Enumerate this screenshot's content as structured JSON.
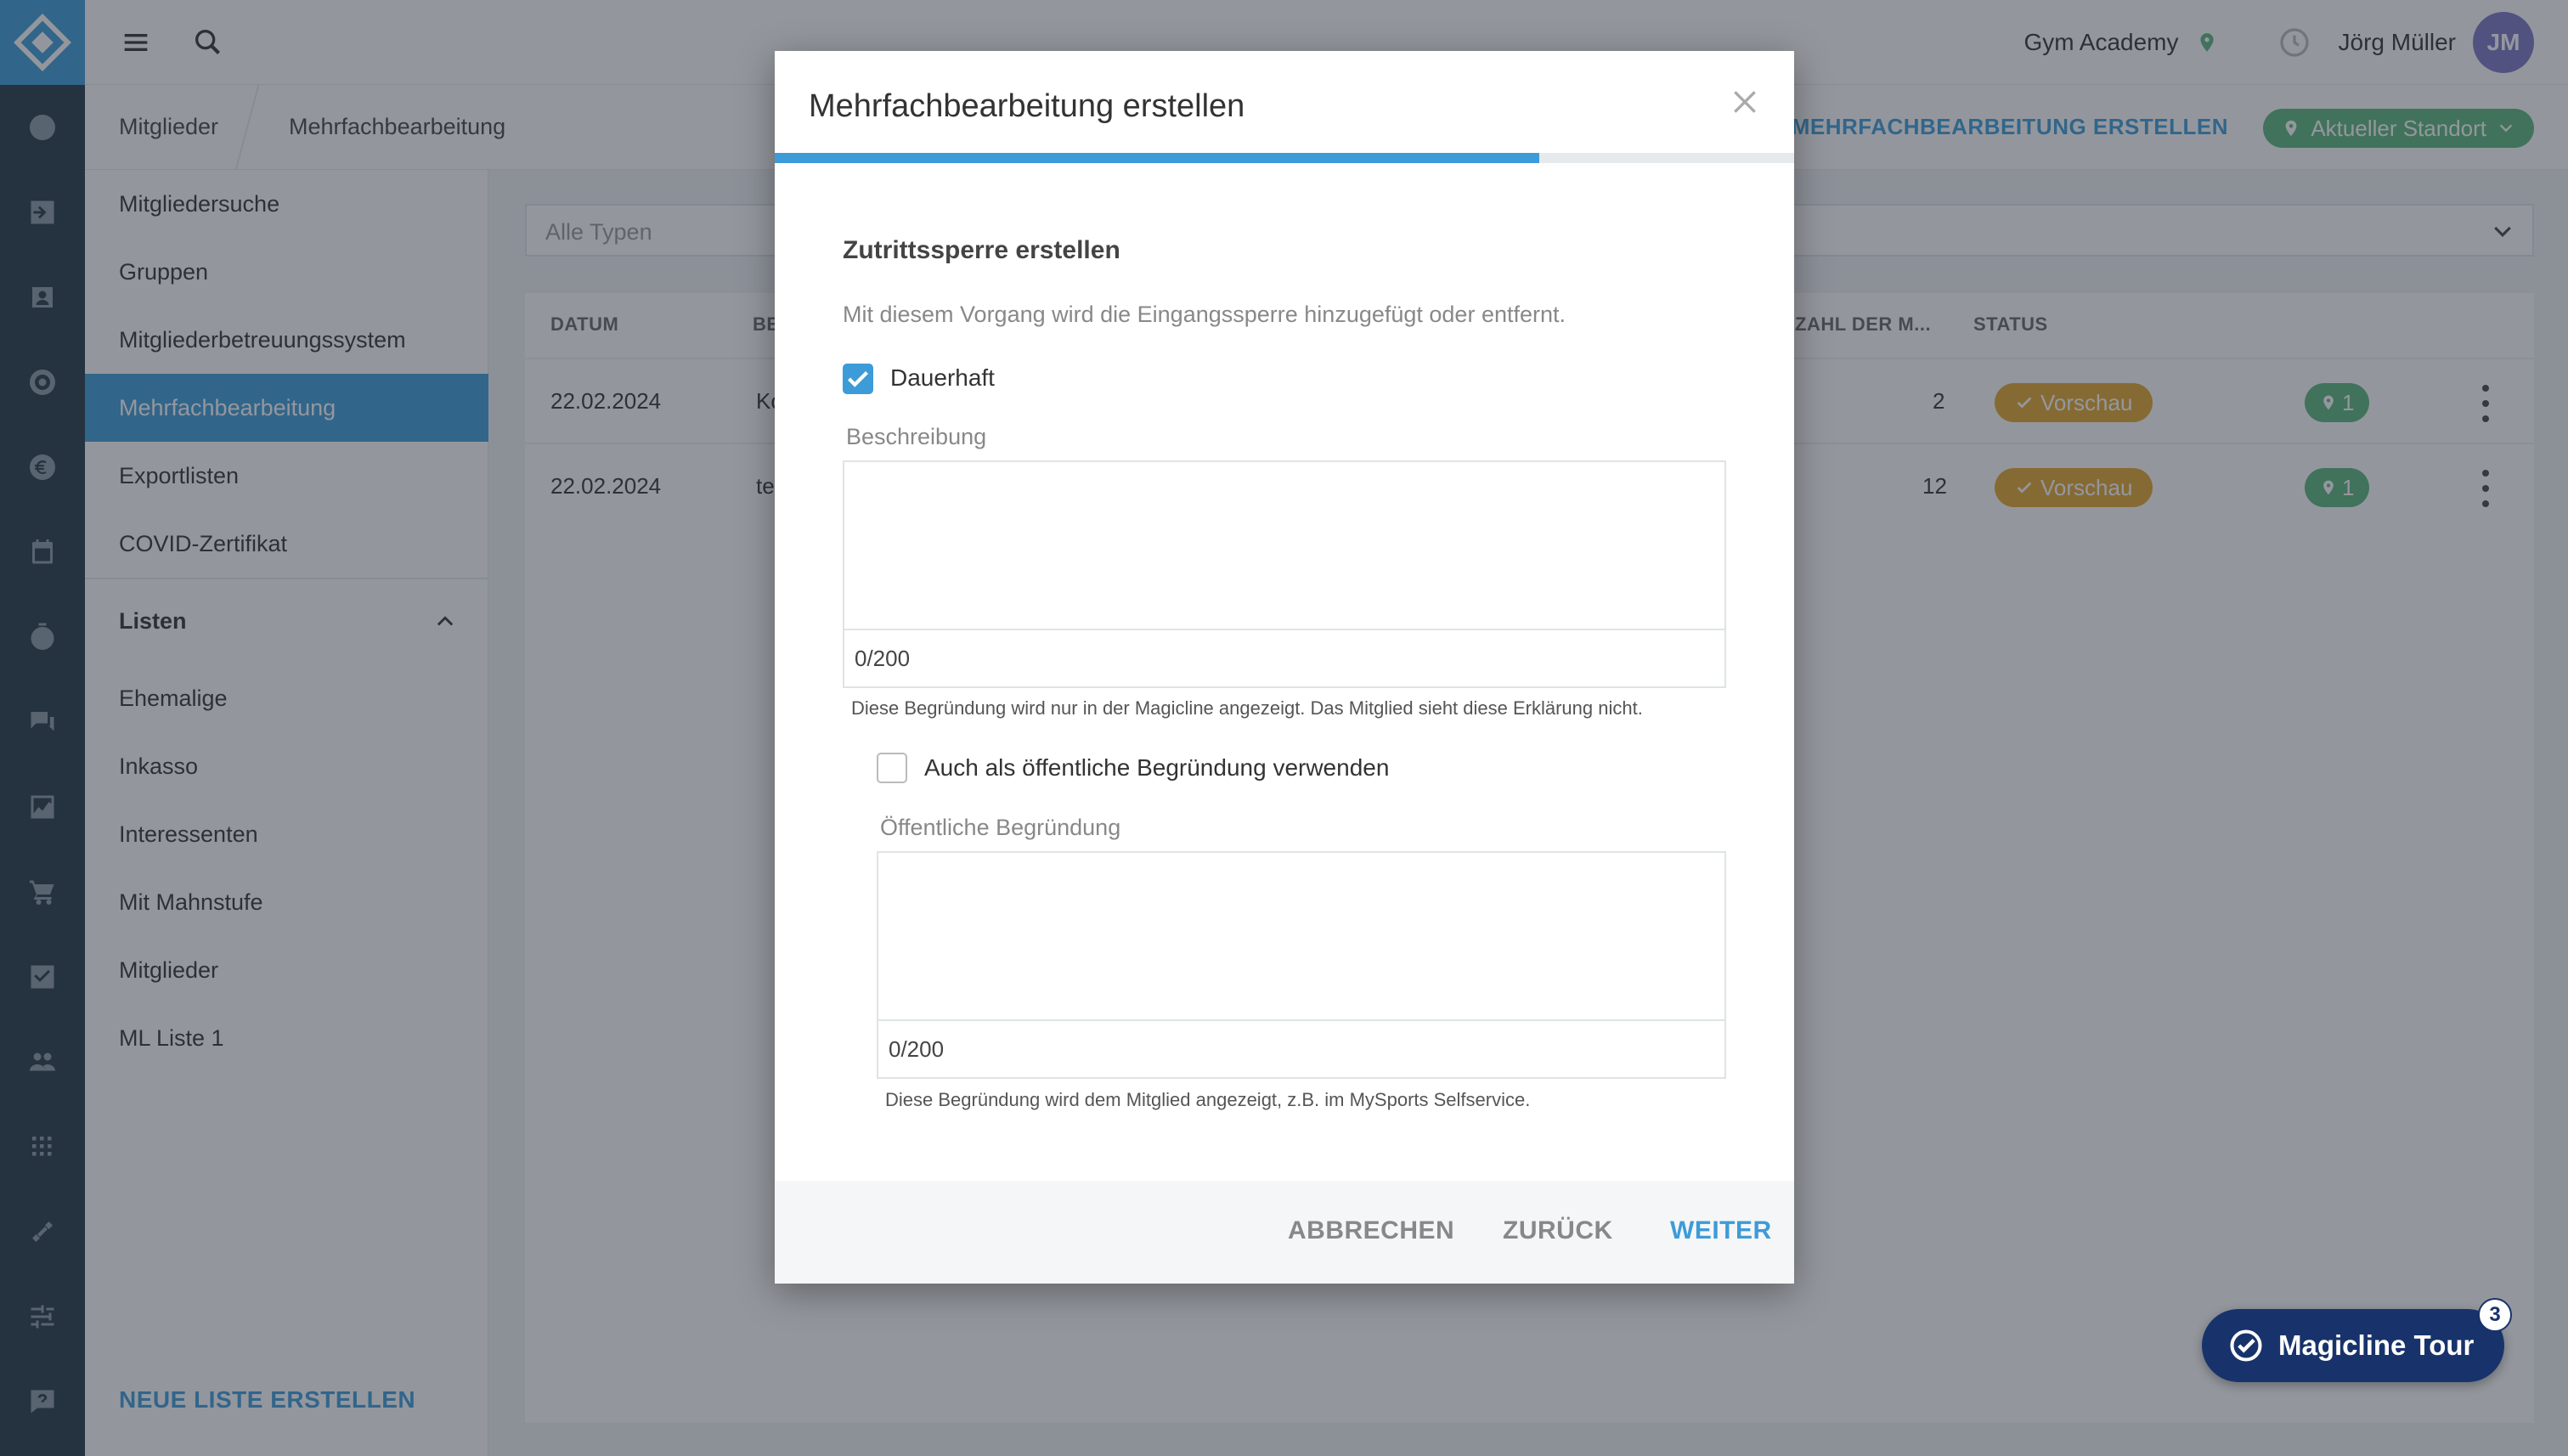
{
  "topbar": {
    "studio": "Gym Academy",
    "user_name": "Jörg Müller",
    "avatar_initials": "JM"
  },
  "breadcrumb": {
    "items": [
      "Mitglieder",
      "Mehrfachbearbeitung"
    ],
    "action": "MEHRFACHBEARBEITUNG ERSTELLEN",
    "location_button": "Aktueller Standort"
  },
  "sidebar": {
    "items": [
      "Mitgliedersuche",
      "Gruppen",
      "Mitgliederbetreuungssystem",
      "Mehrfachbearbeitung",
      "Exportlisten",
      "COVID-Zertifikat"
    ],
    "active_index": 3,
    "section_title": "Listen",
    "lists": [
      "Ehemalige",
      "Inkasso",
      "Interessenten",
      "Mit Mahnstufe",
      "Mitglieder",
      "ML Liste 1"
    ],
    "footer": "NEUE LISTE ERSTELLEN"
  },
  "filter": {
    "placeholder": "Alle Typen"
  },
  "table": {
    "headers": [
      "DATUM",
      "BE",
      "ZAHL DER M...",
      "STATUS"
    ],
    "rows": [
      {
        "date": "22.02.2024",
        "desc": "Ko",
        "count": "2",
        "status": "Vorschau",
        "locations": "1"
      },
      {
        "date": "22.02.2024",
        "desc": "te",
        "count": "12",
        "status": "Vorschau",
        "locations": "1"
      }
    ]
  },
  "modal": {
    "title": "Mehrfachbearbeitung erstellen",
    "progress": 0.75,
    "section_title": "Zutrittssperre erstellen",
    "section_desc": "Mit diesem Vorgang wird die Eingangssperre hinzugefügt oder entfernt.",
    "permanent_label": "Dauerhaft",
    "permanent_checked": true,
    "description_label": "Beschreibung",
    "description_counter": "0/200",
    "description_hint": "Diese Begründung wird nur in der Magicline angezeigt. Das Mitglied sieht diese Erklärung nicht.",
    "public_checkbox_label": "Auch als öffentliche Begründung verwenden",
    "public_checked": false,
    "public_label": "Öffentliche Begründung",
    "public_counter": "0/200",
    "public_hint": "Diese Begründung wird dem Mitglied angezeigt, z.B. im MySports Selfservice.",
    "cancel": "ABBRECHEN",
    "back": "ZURÜCK",
    "next": "WEITER"
  },
  "tour": {
    "label": "Magicline Tour",
    "count": "3"
  },
  "colors": {
    "accent": "#3d9bd8",
    "rail": "#233445",
    "success": "#5ab57b",
    "warning": "#e4a42a",
    "tour": "#18336b"
  }
}
